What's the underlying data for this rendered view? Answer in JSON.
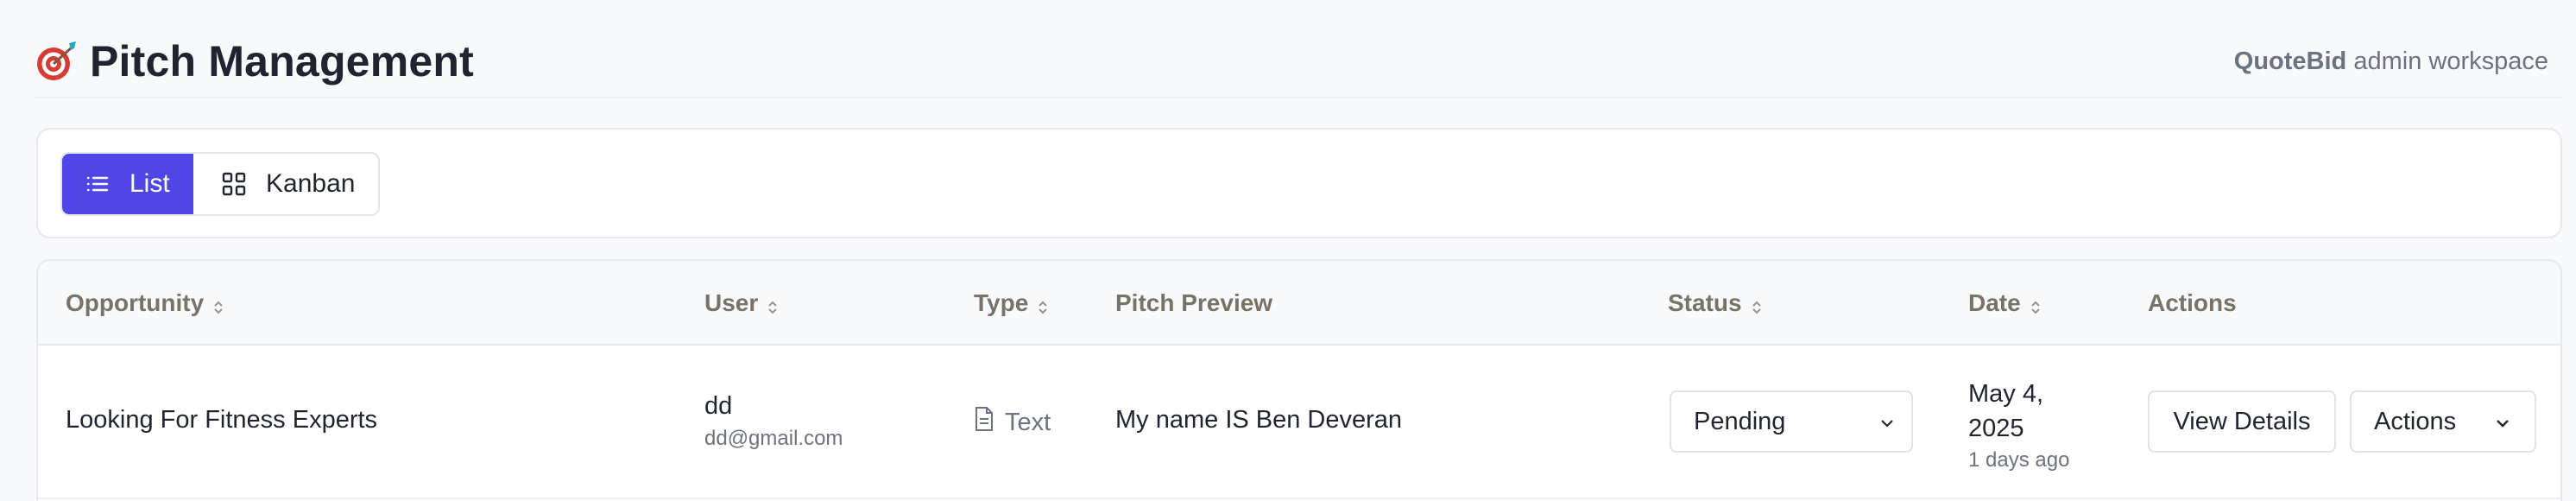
{
  "header": {
    "title": "Pitch Management",
    "title_icon": "target-icon",
    "subtitle_brand": "QuoteBid",
    "subtitle_rest": "admin workspace"
  },
  "view_toggle": {
    "list_label": "List",
    "kanban_label": "Kanban",
    "active": "list",
    "accent_color": "#4f46e5"
  },
  "table": {
    "columns": [
      {
        "label": "Opportunity",
        "sortable": true
      },
      {
        "label": "User",
        "sortable": true
      },
      {
        "label": "Type",
        "sortable": true
      },
      {
        "label": "Pitch Preview",
        "sortable": false
      },
      {
        "label": "Status",
        "sortable": true
      },
      {
        "label": "Date",
        "sortable": true
      },
      {
        "label": "Actions",
        "sortable": false
      }
    ],
    "rows": [
      {
        "opportunity": "Looking For Fitness Experts",
        "user_name": "dd",
        "user_email": "dd@gmail.com",
        "type": "Text",
        "pitch_preview": "My name IS Ben Deveran",
        "status": "Pending",
        "date_line1": "May 4,",
        "date_line2": "2025",
        "date_relative": "1 days ago",
        "view_label": "View Details",
        "actions_label": "Actions"
      }
    ]
  }
}
